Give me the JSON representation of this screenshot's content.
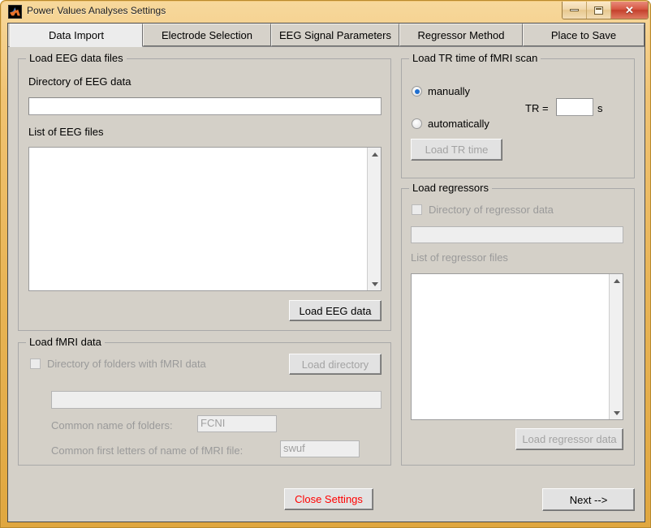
{
  "window": {
    "title": "Power Values Analyses Settings",
    "icon": "matlab-logo-icon",
    "minimize_label": "",
    "maximize_label": "",
    "close_label": "✕"
  },
  "tabs": [
    {
      "label": "Data Import",
      "active": true
    },
    {
      "label": "Electrode Selection",
      "active": false
    },
    {
      "label": "EEG Signal Parameters",
      "active": false
    },
    {
      "label": "Regressor Method",
      "active": false
    },
    {
      "label": "Place to Save",
      "active": false
    }
  ],
  "eeg_panel": {
    "title": "Load EEG data files",
    "directory_label": "Directory of EEG data",
    "directory_value": "",
    "list_label": "List of EEG files",
    "list_items": [],
    "load_button": "Load EEG data"
  },
  "fmri_panel": {
    "title": "Load fMRI data",
    "checkbox_label": "Directory of folders with fMRI data",
    "checkbox_checked": false,
    "load_directory_button": "Load directory",
    "directory_value": "",
    "common_folder_label": "Common name of folders:",
    "common_folder_value": "FCNI",
    "common_file_label": "Common first letters of name of fMRI file:",
    "common_file_value": "swuf"
  },
  "tr_panel": {
    "title": "Load TR time of fMRI scan",
    "radio_manually": "manually",
    "radio_automatically": "automatically",
    "selected": "manually",
    "tr_label": "TR =",
    "tr_value": "",
    "tr_unit": "s",
    "load_button": "Load TR time"
  },
  "regressor_panel": {
    "title": "Load regressors",
    "checkbox_label": "Directory of regressor data",
    "checkbox_checked": false,
    "directory_value": "",
    "list_label": "List of regressor files",
    "list_items": [],
    "load_button": "Load regressor data"
  },
  "footer": {
    "close_button": "Close Settings",
    "next_button": "Next -->"
  },
  "colors": {
    "window_border": "#e2a948",
    "client_bg": "#d4d0c8",
    "active_tab_bg": "#ececec",
    "danger_text": "#ff0000",
    "radio_accent": "#1f6fd0"
  }
}
